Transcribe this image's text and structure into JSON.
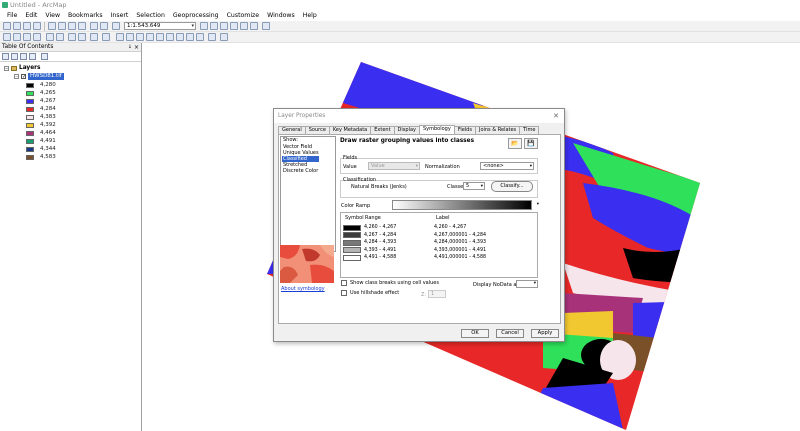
{
  "window": {
    "title": "Untitled - ArcMap"
  },
  "menu": [
    "File",
    "Edit",
    "View",
    "Bookmarks",
    "Insert",
    "Selection",
    "Geoprocessing",
    "Customize",
    "Windows",
    "Help"
  ],
  "toolbar": {
    "scale": "1:1.543.649"
  },
  "toc": {
    "title": "Table Of Contents",
    "pin": "↓",
    "close": "×",
    "root": "Layers",
    "layer_name": "HWSD81.tif",
    "legend": [
      {
        "label": "4,280",
        "color": "#000000"
      },
      {
        "label": "4,265",
        "color": "#2ee05a"
      },
      {
        "label": "4,267",
        "color": "#3a2ef0"
      },
      {
        "label": "4,284",
        "color": "#e82828"
      },
      {
        "label": "4,383",
        "color": "#f6e6ec"
      },
      {
        "label": "4,392",
        "color": "#f2c830"
      },
      {
        "label": "4,464",
        "color": "#a8327a"
      },
      {
        "label": "4,491",
        "color": "#18a070"
      },
      {
        "label": "4,344",
        "color": "#163a8a"
      },
      {
        "label": "4,583",
        "color": "#7a5028"
      }
    ]
  },
  "dialog": {
    "title": "Layer Properties",
    "close": "✕",
    "tabs": [
      "General",
      "Source",
      "Key Metadata",
      "Extent",
      "Display",
      "Symbology",
      "Fields",
      "Joins & Relates",
      "Time"
    ],
    "active_tab": "Symbology",
    "show_label": "Show:",
    "show_items": [
      "Vector Field",
      "Unique Values",
      "Classified",
      "Stretched",
      "Discrete Color"
    ],
    "selected_show": "Classified",
    "heading": "Draw raster grouping values into classes",
    "open_icon": "📂",
    "save_icon": "💾",
    "fields_label": "Fields",
    "value_label": "Value",
    "value_select": "Value",
    "normalization_label": "Normalization",
    "normalization_select": "<none>",
    "classification_label": "Classification",
    "method": "Natural Breaks (Jenks)",
    "classes_label": "Classes",
    "classes_value": "5",
    "classify_button": "Classify...",
    "color_ramp_label": "Color Ramp",
    "table_headers": {
      "symbol": "Symbol",
      "range": "Range",
      "label": "Label"
    },
    "rows": [
      {
        "color": "#000000",
        "range": "4,260 - 4,267",
        "label": "4,260 - 4,267"
      },
      {
        "color": "#3c3c3c",
        "range": "4,267 - 4,284",
        "label": "4,267,000001 - 4,284"
      },
      {
        "color": "#787878",
        "range": "4,284 - 4,393",
        "label": "4,284,000001 - 4,393"
      },
      {
        "color": "#b4b4b4",
        "range": "4,393 - 4,491",
        "label": "4,393,000001 - 4,491"
      },
      {
        "color": "#ffffff",
        "range": "4,491 - 4,588",
        "label": "4,491,000001 - 4,588"
      }
    ],
    "show_breaks_label": "Show class breaks using cell values",
    "hillshade_label": "Use hillshade effect",
    "hillshade_z_label": "Z:",
    "hillshade_z": "1",
    "nodata_label": "Display NoData as",
    "about_link": "About symbology",
    "ok": "OK",
    "cancel": "Cancel",
    "apply": "Apply"
  }
}
